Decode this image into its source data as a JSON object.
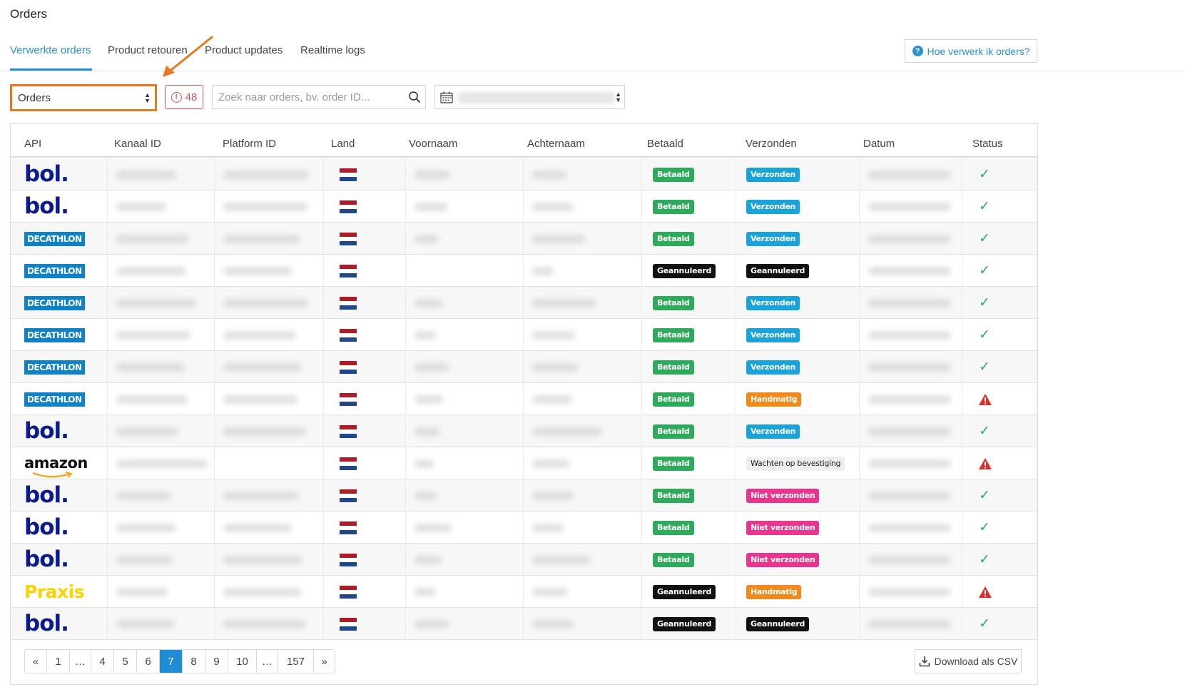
{
  "page": {
    "title": "Orders"
  },
  "tabs": [
    {
      "label": "Verwerkte orders",
      "active": true
    },
    {
      "label": "Product retouren",
      "active": false
    },
    {
      "label": "Product updates",
      "active": false
    },
    {
      "label": "Realtime logs",
      "active": false
    }
  ],
  "help_button": {
    "label": "Hoe verwerk ik orders?"
  },
  "filters": {
    "type_select": {
      "value": "Orders"
    },
    "error_count": "48",
    "search": {
      "placeholder": "Zoek naar orders, bv. order ID...",
      "value": ""
    }
  },
  "table": {
    "headers": [
      "API",
      "Kanaal ID",
      "Platform ID",
      "Land",
      "Voornaam",
      "Achternaam",
      "Betaald",
      "Verzonden",
      "Datum",
      "Status"
    ],
    "rows": [
      {
        "api": "bol",
        "betaald": "Betaald",
        "verzonden": "Verzonden",
        "status": "ok"
      },
      {
        "api": "bol",
        "betaald": "Betaald",
        "verzonden": "Verzonden",
        "status": "ok"
      },
      {
        "api": "decathlon",
        "betaald": "Betaald",
        "verzonden": "Verzonden",
        "status": "ok"
      },
      {
        "api": "decathlon",
        "betaald": "Geannuleerd",
        "verzonden": "Geannuleerd",
        "status": "ok"
      },
      {
        "api": "decathlon",
        "betaald": "Betaald",
        "verzonden": "Verzonden",
        "status": "ok"
      },
      {
        "api": "decathlon",
        "betaald": "Betaald",
        "verzonden": "Verzonden",
        "status": "ok"
      },
      {
        "api": "decathlon",
        "betaald": "Betaald",
        "verzonden": "Verzonden",
        "status": "ok"
      },
      {
        "api": "decathlon",
        "betaald": "Betaald",
        "verzonden": "Handmatig",
        "status": "warning"
      },
      {
        "api": "bol",
        "betaald": "Betaald",
        "verzonden": "Verzonden",
        "status": "ok"
      },
      {
        "api": "amazon",
        "betaald": "Betaald",
        "verzonden": "Wachten op bevestiging",
        "status": "warning"
      },
      {
        "api": "bol",
        "betaald": "Betaald",
        "verzonden": "Niet verzonden",
        "status": "ok"
      },
      {
        "api": "bol",
        "betaald": "Betaald",
        "verzonden": "Niet verzonden",
        "status": "ok"
      },
      {
        "api": "bol",
        "betaald": "Betaald",
        "verzonden": "Niet verzonden",
        "status": "ok"
      },
      {
        "api": "praxis",
        "betaald": "Geannuleerd",
        "verzonden": "Handmatig",
        "status": "warning"
      },
      {
        "api": "bol",
        "betaald": "Geannuleerd",
        "verzonden": "Geannuleerd",
        "status": "ok"
      }
    ]
  },
  "logos": {
    "bol": "bol.",
    "decathlon": "DECATHLON",
    "amazon": "amazon",
    "praxis": "Praxis"
  },
  "badge_colors": {
    "Betaald": "#2eaa5b",
    "Verzonden": "#1aa3d9",
    "Geannuleerd": "#111111",
    "Handmatig": "#f08a1c",
    "Niet verzonden": "#e8368f",
    "Wachten op bevestiging": "#eeeeee"
  },
  "status_colors": {
    "ok": "#2eaa5b",
    "warning": "#d9302c"
  },
  "flag_colors": [
    "#ae1c28",
    "#ffffff",
    "#21468b"
  ],
  "pagination": {
    "pages": [
      "«",
      "1",
      "...",
      "4",
      "5",
      "6",
      "7",
      "8",
      "9",
      "10",
      "...",
      "157",
      "»"
    ],
    "current": "7"
  },
  "csv_button": {
    "label": "Download als CSV"
  },
  "icons": {
    "search": "search-icon",
    "calendar": "calendar-icon",
    "help": "help-circle-icon",
    "error": "error-circle-icon",
    "download": "download-icon"
  }
}
